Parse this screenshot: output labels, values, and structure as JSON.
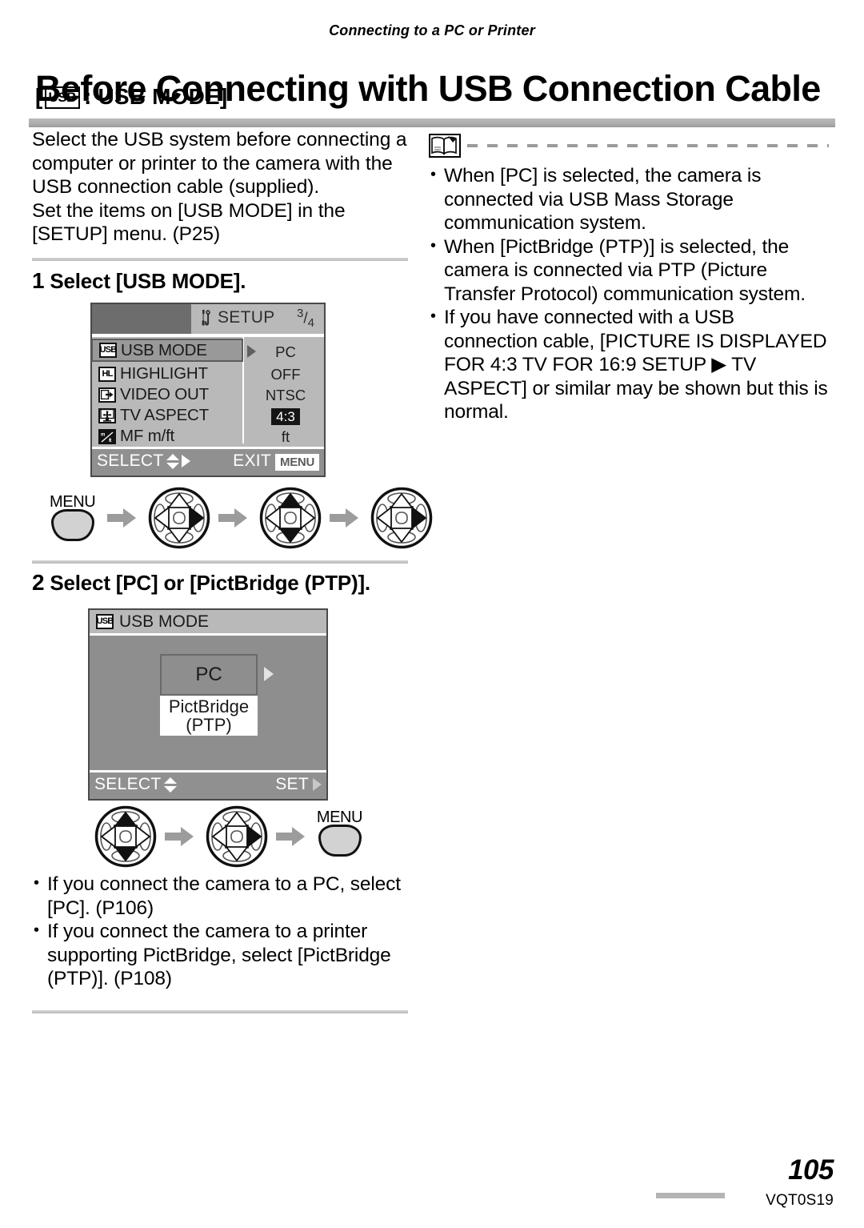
{
  "document": {
    "running_head": "Connecting to a PC or Printer",
    "title": "Before Connecting with USB Connection Cable",
    "subtitle_prefix": "[",
    "subtitle_icon": "USB",
    "subtitle_suffix": ": USB MODE]",
    "page_number": "105",
    "doc_code": "VQT0S19"
  },
  "intro": {
    "paragraph1": "Select the USB system before connecting a computer or printer to the camera with the USB connection cable (supplied).",
    "paragraph2": "Set the items on [USB MODE] in the [SETUP] menu. (P25)"
  },
  "steps": [
    {
      "number": "1",
      "heading": "Select [USB MODE]."
    },
    {
      "number": "2",
      "heading": "Select [PC] or [PictBridge (PTP)]."
    }
  ],
  "lcd_setup": {
    "title": "SETUP",
    "page_indicator_num": "3",
    "page_indicator_den": "4",
    "wrench_icon": "wrench-spanner-icon",
    "rows": [
      {
        "icon": "USB",
        "icon_name": "usb-icon",
        "label": "USB  MODE",
        "value": "PC",
        "selected": true,
        "inverted": false
      },
      {
        "icon": "HL",
        "icon_name": "highlight-icon",
        "label": "HIGHLIGHT",
        "value": "OFF",
        "selected": false,
        "inverted": false
      },
      {
        "icon": "",
        "icon_name": "video-out-icon",
        "label": "VIDEO OUT",
        "value": "NTSC",
        "selected": false,
        "inverted": false
      },
      {
        "icon": "",
        "icon_name": "tv-aspect-icon",
        "label": "TV ASPECT",
        "value": "4:3",
        "selected": false,
        "inverted": true
      },
      {
        "icon": "",
        "icon_name": "mf-meter-feet-icon",
        "label": "MF m/ft",
        "value": "ft",
        "selected": false,
        "inverted": false
      }
    ],
    "footer_left": "SELECT",
    "footer_right": "EXIT",
    "footer_right_chip": "MENU"
  },
  "lcd_usbmode": {
    "title": "USB MODE",
    "icon": "USB",
    "option_pc": "PC",
    "option_ptp_line1": "PictBridge",
    "option_ptp_line2": "(PTP)",
    "footer_left": "SELECT",
    "footer_right": "SET"
  },
  "button_sequence_1": [
    {
      "type": "menu-button",
      "label": "MENU"
    },
    {
      "type": "dial",
      "active": "right"
    },
    {
      "type": "dial",
      "active": "up-down"
    },
    {
      "type": "dial",
      "active": "right"
    }
  ],
  "button_sequence_2": [
    {
      "type": "dial",
      "active": "up-down"
    },
    {
      "type": "dial",
      "active": "right"
    },
    {
      "type": "menu-button",
      "label": "MENU"
    }
  ],
  "notes": {
    "icon": "book-note-icon",
    "items": [
      "When [PC] is selected, the camera is connected via USB Mass Storage communication system.",
      "When [PictBridge (PTP)] is selected, the camera is connected via PTP (Picture Transfer Protocol) communication system.",
      "If you have connected with a USB connection cable, [PICTURE IS DISPLAYED FOR 4:3 TV FOR 16:9 SETUP ▶ TV ASPECT] or similar may be shown but this is normal."
    ]
  },
  "step2_notes": [
    "If you connect the camera to a PC, select [PC]. (P106)",
    "If you connect the camera to a printer supporting PictBridge, select [PictBridge (PTP)]. (P108)"
  ],
  "colors": {
    "rule": "#b0b0b0",
    "lcd_background": "#b9b9b9",
    "lcd_selected": "#999999",
    "lcd_footer": "#909090",
    "lcd2_background": "#8e8e8e",
    "arrow_gray": "#9c9c9c",
    "button_fill": "#d2d2d2"
  }
}
